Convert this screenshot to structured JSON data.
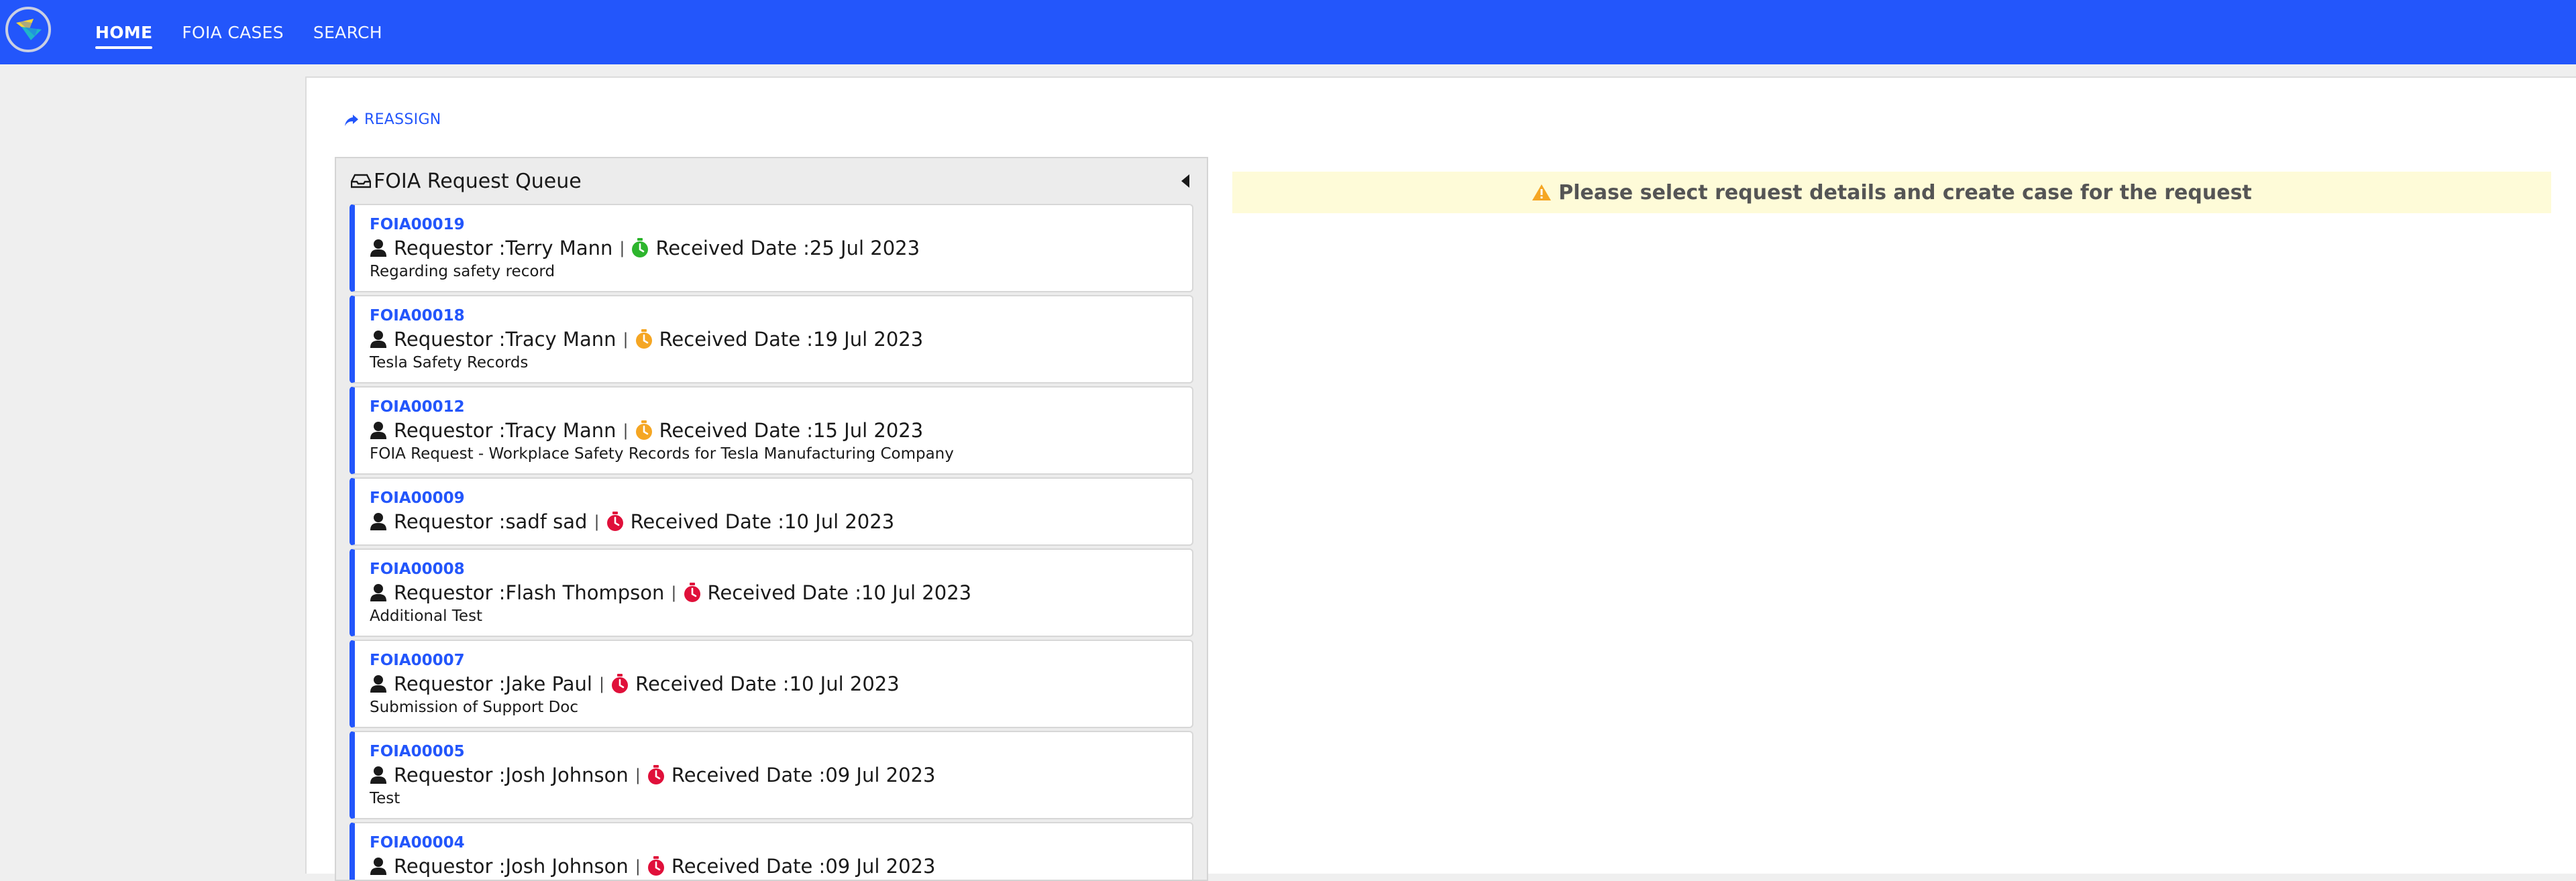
{
  "nav": {
    "items": [
      {
        "label": "HOME",
        "active": true
      },
      {
        "label": "FOIA CASES",
        "active": false
      },
      {
        "label": "SEARCH",
        "active": false
      }
    ]
  },
  "toolbar": {
    "reassign_label": "REASSIGN"
  },
  "queue": {
    "title": "FOIA Request Queue",
    "requestor_prefix": "Requestor : ",
    "received_prefix": "Received Date : ",
    "items": [
      {
        "id": "FOIA00019",
        "requestor": "Terry Mann",
        "received": "25 Jul 2023",
        "status": "green",
        "desc": "Regarding safety record"
      },
      {
        "id": "FOIA00018",
        "requestor": "Tracy Mann",
        "received": "19 Jul 2023",
        "status": "orange",
        "desc": "Tesla Safety Records"
      },
      {
        "id": "FOIA00012",
        "requestor": "Tracy Mann",
        "received": "15 Jul 2023",
        "status": "orange",
        "desc": "FOIA Request - Workplace Safety Records for Tesla Manufacturing Company"
      },
      {
        "id": "FOIA00009",
        "requestor": "sadf sad",
        "received": "10 Jul 2023",
        "status": "red",
        "desc": ""
      },
      {
        "id": "FOIA00008",
        "requestor": "Flash Thompson",
        "received": "10 Jul 2023",
        "status": "red",
        "desc": "Additional Test"
      },
      {
        "id": "FOIA00007",
        "requestor": "Jake Paul",
        "received": "10 Jul 2023",
        "status": "red",
        "desc": "Submission of Support Doc"
      },
      {
        "id": "FOIA00005",
        "requestor": "Josh Johnson",
        "received": "09 Jul 2023",
        "status": "red",
        "desc": "Test"
      },
      {
        "id": "FOIA00004",
        "requestor": "Josh Johnson",
        "received": "09 Jul 2023",
        "status": "red",
        "desc": ""
      }
    ]
  },
  "alert": {
    "message": "Please select request details and create case for the request"
  },
  "colors": {
    "brand": "#2356fb",
    "green": "#2db52d",
    "orange": "#f5a623",
    "red": "#e0103a",
    "alert_bg": "#fefbd8"
  },
  "icons": {
    "logo": "app-logo-icon",
    "reassign": "share-arrow-icon",
    "queue": "inbox-icon",
    "requestor": "user-icon",
    "received": "stopwatch-icon",
    "alert": "warning-icon"
  }
}
